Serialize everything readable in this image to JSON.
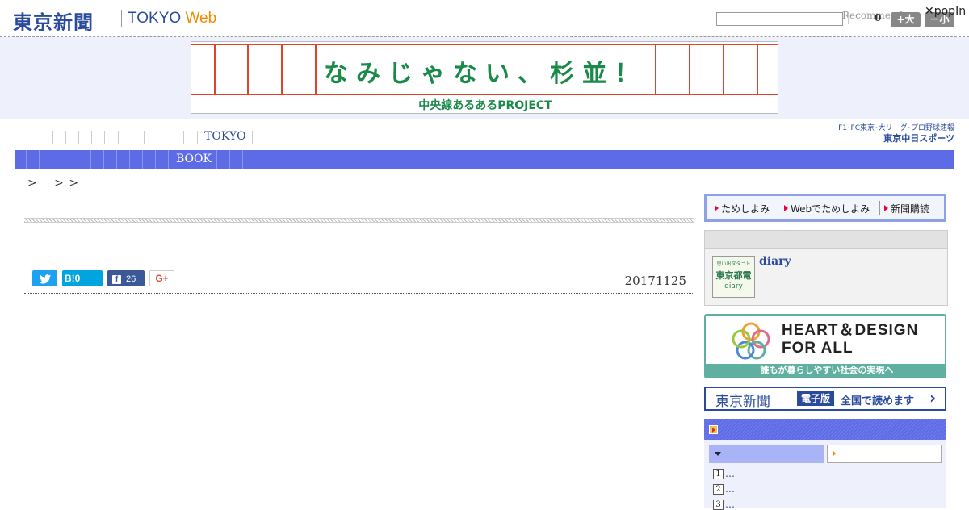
{
  "header": {
    "logo_jp": "東京新聞",
    "logo_en_main": "TOKYO",
    "logo_en_web": "Web",
    "search_placeholder": "",
    "recommend": "Recommend",
    "count": "0",
    "size_big": "+大",
    "size_small": "－小",
    "popin": "✕popIn"
  },
  "banner": {
    "title": "なみじゃない、杉並！",
    "subtitle": "中央線あるあるPROJECT"
  },
  "nav": {
    "tokyo": "TOKYO",
    "book": "BOOK",
    "chunichi_line1": "F1･FC東京･大リーグ･プロ野球速報",
    "chunichi_line2": "東京中日スポーツ"
  },
  "breadcrumb": ">　 > >",
  "article": {
    "share_hatena": "B!0",
    "share_fb_count": "26",
    "share_gplus": "G+",
    "date": "20171125"
  },
  "sidebar": {
    "trial": [
      "ためしよみ",
      "Webでためしよみ",
      "新聞購読"
    ],
    "diary_thumb_top": "思い出ダタゴト",
    "diary_thumb_mid": "東京都電",
    "diary_thumb_bottom": "diary",
    "diary_link": "diary",
    "heart_line1": "HEART＆DESIGN",
    "heart_line2": "FOR ALL",
    "heart_foot": "誰もが暮らしやすい社会の実現へ",
    "denshi_logo": "東京新聞",
    "denshi_badge": "電子版",
    "denshi_text": "全国で読めます",
    "denshi_chevron": "›",
    "ranking": [
      {
        "num": "1",
        "text": "…"
      },
      {
        "num": "2",
        "text": "…"
      },
      {
        "num": "3",
        "text": "…"
      }
    ]
  }
}
